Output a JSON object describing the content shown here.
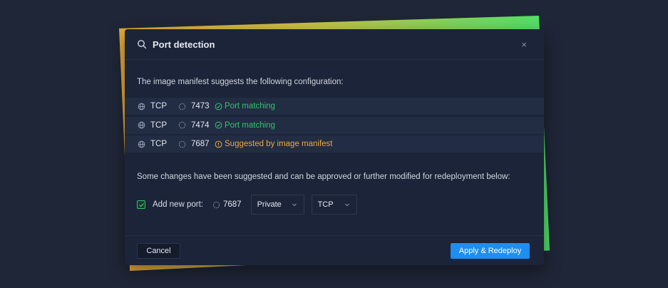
{
  "dialog": {
    "title": "Port detection",
    "close_label": "×",
    "intro": "The image manifest suggests the following configuration:",
    "ports": [
      {
        "protocol": "TCP",
        "port": "7473",
        "status": "Port matching",
        "status_type": "ok"
      },
      {
        "protocol": "TCP",
        "port": "7474",
        "status": "Port matching",
        "status_type": "ok"
      },
      {
        "protocol": "TCP",
        "port": "7687",
        "status": "Suggested by image manifest",
        "status_type": "warn"
      }
    ],
    "note": "Some changes have been suggested and can be approved or further modified for redeployment below:",
    "add_port": {
      "checked": true,
      "label": "Add new port:",
      "port": "7687",
      "visibility": "Private",
      "protocol": "TCP"
    },
    "footer": {
      "cancel_label": "Cancel",
      "apply_label": "Apply & Redeploy"
    }
  },
  "colors": {
    "background": "#1f2637",
    "dialog": "#1b2438",
    "row": "#222c43",
    "success": "#32c36a",
    "warning": "#e8a93a",
    "primary": "#1e8ef0"
  },
  "icons": {
    "title": "search-icon",
    "close": "close-icon",
    "protocol": "globe-icon",
    "port": "port-dashed-circle-icon",
    "ok": "check-circle-icon",
    "warn": "exclamation-circle-icon",
    "dropdown": "chevron-down-icon"
  }
}
